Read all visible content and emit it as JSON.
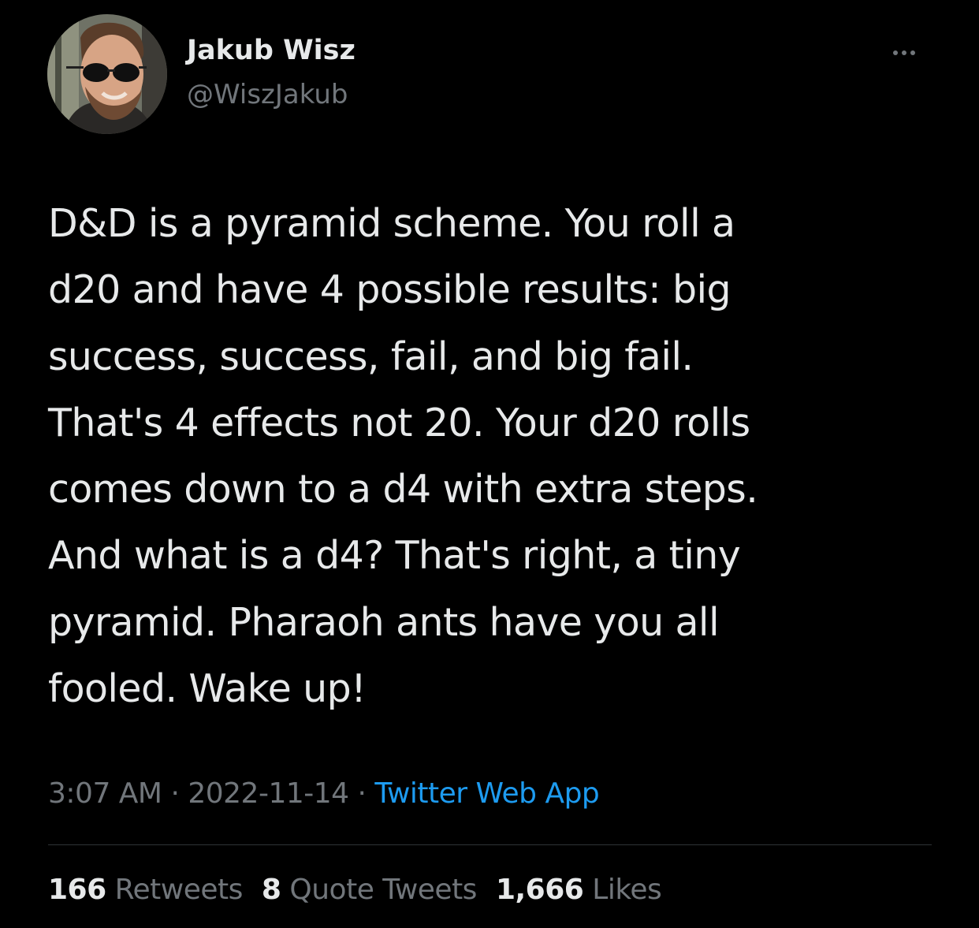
{
  "author": {
    "name": "Jakub Wisz",
    "handle": "@WiszJakub"
  },
  "tweet": {
    "lines": [
      "D&D is a pyramid scheme. You roll a",
      "d20 and have 4 possible results: big",
      "success, success, fail, and big fail.",
      "That's 4 effects not 20. Your d20 rolls",
      "comes down to a d4 with extra steps.",
      "And what is a d4? That's right, a tiny",
      "pyramid. Pharaoh ants have you all",
      "fooled. Wake up!"
    ],
    "time": "3:07 AM",
    "separator": "·",
    "date": "2022-11-14",
    "source": "Twitter Web App"
  },
  "stats": {
    "retweets_count": "166",
    "retweets_label": "Retweets",
    "quotes_count": "8",
    "quotes_label": "Quote Tweets",
    "likes_count": "1,666",
    "likes_label": "Likes"
  },
  "icons": {
    "more": "more-horizontal-icon"
  },
  "colors": {
    "background": "#000000",
    "text": "#e7e9ea",
    "secondary": "#71767b",
    "link": "#1d9bf0",
    "divider": "#2f3336"
  }
}
